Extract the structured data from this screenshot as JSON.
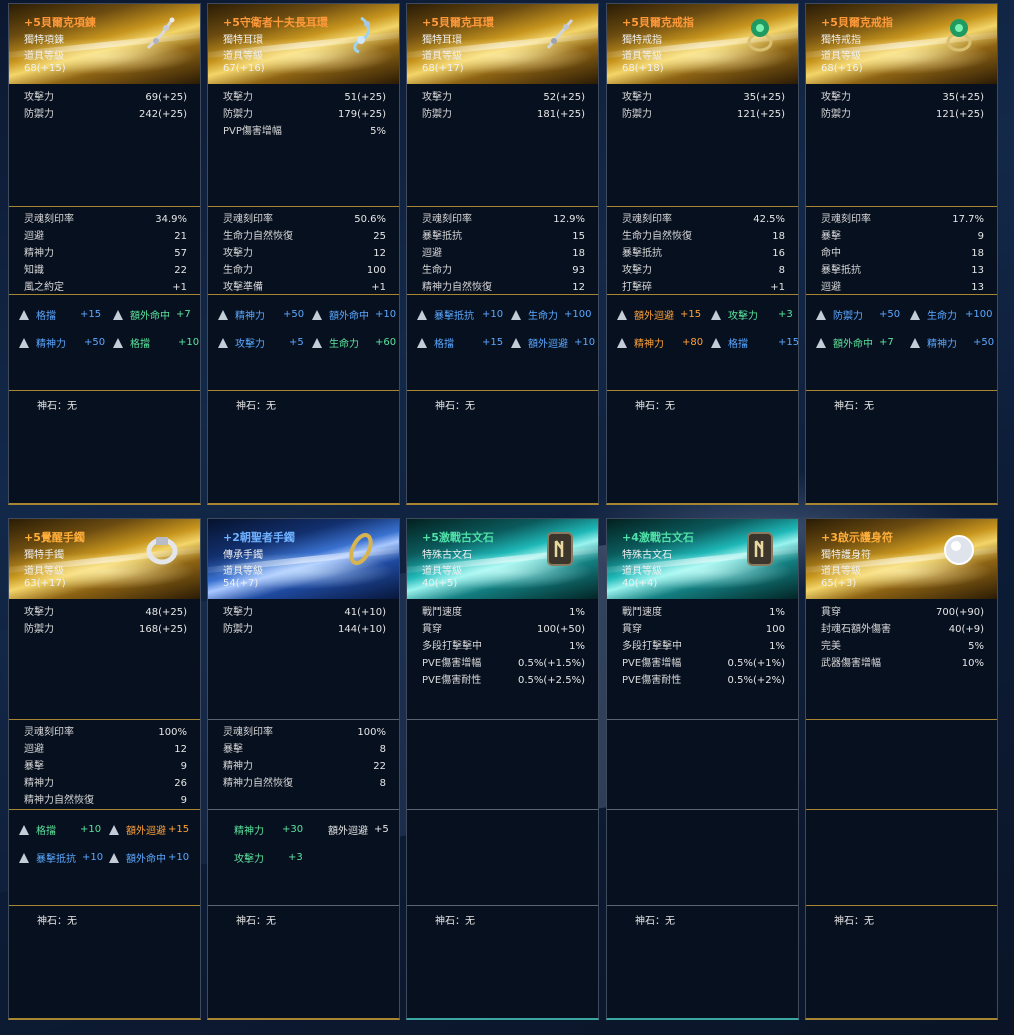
{
  "common": {
    "stone_label": "神石：无"
  },
  "cards": [
    {
      "title": "+5貝爾克項鍊",
      "type_label": "獨特項鍊",
      "level_label": "道具等級",
      "level_value": "68(+15)",
      "stats": [
        [
          "攻擊力",
          "69(+25)"
        ],
        [
          "防禦力",
          "242(+25)"
        ]
      ],
      "extra": [
        [
          "灵魂刻印率",
          "34.9%"
        ],
        [
          "迴避",
          "21"
        ],
        [
          "精神力",
          "57"
        ],
        [
          "知識",
          "22"
        ],
        [
          "風之約定",
          "+1"
        ]
      ],
      "insc": [
        {
          "name": "格擋",
          "val": "+15",
          "color": "blue"
        },
        {
          "name": "額外命中",
          "val": "+7",
          "color": "green"
        },
        {
          "name": "精神力",
          "val": "+50",
          "color": "blue"
        },
        {
          "name": "格擋",
          "val": "+10",
          "color": "green"
        }
      ]
    },
    {
      "title": "+5守衛者十夫長耳環",
      "type_label": "獨特耳環",
      "level_label": "道具等級",
      "level_value": "67(+16)",
      "stats": [
        [
          "攻擊力",
          "51(+25)"
        ],
        [
          "防禦力",
          "179(+25)"
        ],
        [
          "PVP傷害增幅",
          "5%"
        ]
      ],
      "extra": [
        [
          "灵魂刻印率",
          "50.6%"
        ],
        [
          "生命力自然恢復",
          "25"
        ],
        [
          "攻擊力",
          "12"
        ],
        [
          "生命力",
          "100"
        ],
        [
          "攻擊準備",
          "+1"
        ]
      ],
      "insc": [
        {
          "name": "精神力",
          "val": "+50",
          "color": "blue"
        },
        {
          "name": "額外命中",
          "val": "+10",
          "color": "blue"
        },
        {
          "name": "攻擊力",
          "val": "+5",
          "color": "blue"
        },
        {
          "name": "生命力",
          "val": "+60",
          "color": "green"
        }
      ]
    },
    {
      "title": "+5貝爾克耳環",
      "type_label": "獨特耳環",
      "level_label": "道具等級",
      "level_value": "68(+17)",
      "stats": [
        [
          "攻擊力",
          "52(+25)"
        ],
        [
          "防禦力",
          "181(+25)"
        ]
      ],
      "extra": [
        [
          "灵魂刻印率",
          "12.9%"
        ],
        [
          "暴擊抵抗",
          "15"
        ],
        [
          "迴避",
          "18"
        ],
        [
          "生命力",
          "93"
        ],
        [
          "精神力自然恢復",
          "12"
        ]
      ],
      "insc": [
        {
          "name": "暴擊抵抗",
          "val": "+10",
          "color": "blue"
        },
        {
          "name": "生命力",
          "val": "+100",
          "color": "blue"
        },
        {
          "name": "格擋",
          "val": "+15",
          "color": "blue"
        },
        {
          "name": "額外迴避",
          "val": "+10",
          "color": "blue"
        }
      ]
    },
    {
      "title": "+5貝爾克戒指",
      "type_label": "獨特戒指",
      "level_label": "道具等級",
      "level_value": "68(+18)",
      "stats": [
        [
          "攻擊力",
          "35(+25)"
        ],
        [
          "防禦力",
          "121(+25)"
        ]
      ],
      "extra": [
        [
          "灵魂刻印率",
          "42.5%"
        ],
        [
          "生命力自然恢復",
          "18"
        ],
        [
          "暴擊抵抗",
          "16"
        ],
        [
          "攻擊力",
          "8"
        ],
        [
          "打擊碎",
          "+1"
        ]
      ],
      "insc": [
        {
          "name": "額外迴避",
          "val": "+15",
          "color": "orange"
        },
        {
          "name": "攻擊力",
          "val": "+3",
          "color": "green"
        },
        {
          "name": "精神力",
          "val": "+80",
          "color": "orange"
        },
        {
          "name": "格擋",
          "val": "+15",
          "color": "blue"
        }
      ]
    },
    {
      "title": "+5貝爾克戒指",
      "type_label": "獨特戒指",
      "level_label": "道具等級",
      "level_value": "68(+16)",
      "stats": [
        [
          "攻擊力",
          "35(+25)"
        ],
        [
          "防禦力",
          "121(+25)"
        ]
      ],
      "extra": [
        [
          "灵魂刻印率",
          "17.7%"
        ],
        [
          "暴擊",
          "9"
        ],
        [
          "命中",
          "18"
        ],
        [
          "暴擊抵抗",
          "13"
        ],
        [
          "迴避",
          "13"
        ]
      ],
      "insc": [
        {
          "name": "防禦力",
          "val": "+50",
          "color": "blue"
        },
        {
          "name": "生命力",
          "val": "+100",
          "color": "blue"
        },
        {
          "name": "額外命中",
          "val": "+7",
          "color": "green"
        },
        {
          "name": "精神力",
          "val": "+50",
          "color": "blue"
        }
      ]
    },
    {
      "title": "+5覺醒手鐲",
      "type_label": "獨特手鐲",
      "level_label": "道具等級",
      "level_value": "63(+17)",
      "stats": [
        [
          "攻擊力",
          "48(+25)"
        ],
        [
          "防禦力",
          "168(+25)"
        ]
      ],
      "extra": [
        [
          "灵魂刻印率",
          "100%"
        ],
        [
          "迴避",
          "12"
        ],
        [
          "暴擊",
          "9"
        ],
        [
          "精神力",
          "26"
        ],
        [
          "精神力自然恢復",
          "9"
        ]
      ],
      "insc": [
        {
          "name": "格擋",
          "val": "+10",
          "color": "green"
        },
        {
          "name": "額外迴避",
          "val": "+15",
          "color": "orange"
        },
        {
          "name": "暴擊抵抗",
          "val": "+10",
          "color": "blue"
        },
        {
          "name": "額外命中",
          "val": "+10",
          "color": "blue"
        }
      ]
    },
    {
      "title": "+2朝聖者手鐲",
      "type_label": "傳承手鐲",
      "level_label": "道具等級",
      "level_value": "54(+7)",
      "stats": [
        [
          "攻擊力",
          "41(+10)"
        ],
        [
          "防禦力",
          "144(+10)"
        ]
      ],
      "extra": [
        [
          "灵魂刻印率",
          "100%"
        ],
        [
          "暴擊",
          "8"
        ],
        [
          "精神力",
          "22"
        ],
        [
          "精神力自然恢復",
          "8"
        ]
      ],
      "insc": [
        {
          "name": "精神力",
          "val": "+30",
          "color": "green"
        },
        {
          "name": "額外迴避",
          "val": "+5",
          "color": "white"
        },
        {
          "name": "攻擊力",
          "val": "+3",
          "color": "green"
        }
      ]
    },
    {
      "title": "+5激戰古文石",
      "type_label": "特殊古文石",
      "level_label": "道具等級",
      "level_value": "40(+5)",
      "stats": [
        [
          "戰鬥速度",
          "1%"
        ],
        [
          "貫穿",
          "100(+50)"
        ],
        [
          "多段打擊擊中",
          "1%"
        ],
        [
          "PVE傷害增幅",
          "0.5%(+1.5%)"
        ],
        [
          "PVE傷害耐性",
          "0.5%(+2.5%)"
        ]
      ],
      "extra": [],
      "insc": []
    },
    {
      "title": "+4激戰古文石",
      "type_label": "特殊古文石",
      "level_label": "道具等級",
      "level_value": "40(+4)",
      "stats": [
        [
          "戰鬥速度",
          "1%"
        ],
        [
          "貫穿",
          "100"
        ],
        [
          "多段打擊擊中",
          "1%"
        ],
        [
          "PVE傷害增幅",
          "0.5%(+1%)"
        ],
        [
          "PVE傷害耐性",
          "0.5%(+2%)"
        ]
      ],
      "extra": [],
      "insc": []
    },
    {
      "title": "+3啟示護身符",
      "type_label": "獨特護身符",
      "level_label": "道具等級",
      "level_value": "65(+3)",
      "stats": [
        [
          "貫穿",
          "700(+90)"
        ],
        [
          "封魂石額外傷害",
          "40(+9)"
        ],
        [
          "完美",
          "5%"
        ],
        [
          "武器傷害增幅",
          "10%"
        ]
      ],
      "extra": [],
      "insc": []
    }
  ]
}
